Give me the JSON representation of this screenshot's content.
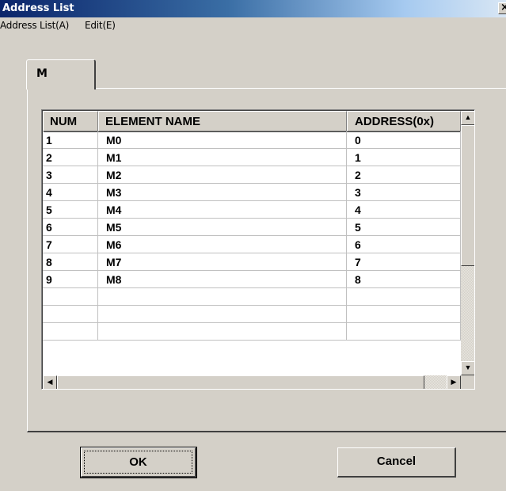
{
  "window": {
    "title": "Address List",
    "close_glyph": "×"
  },
  "menu": [
    {
      "label": "Address List(A)"
    },
    {
      "label": "Edit(E)"
    }
  ],
  "tab": {
    "label": "M"
  },
  "table": {
    "columns": [
      "NUM",
      "ELEMENT NAME",
      "ADDRESS(0x)"
    ],
    "rows": [
      [
        "1",
        "M0",
        "0"
      ],
      [
        "2",
        "M1",
        "1"
      ],
      [
        "3",
        "M2",
        "2"
      ],
      [
        "4",
        "M3",
        "3"
      ],
      [
        "5",
        "M4",
        "4"
      ],
      [
        "6",
        "M5",
        "5"
      ],
      [
        "7",
        "M6",
        "6"
      ],
      [
        "8",
        "M7",
        "7"
      ],
      [
        "9",
        "M8",
        "8"
      ],
      [
        "",
        "",
        ""
      ],
      [
        "",
        "",
        ""
      ],
      [
        "",
        "",
        ""
      ]
    ]
  },
  "scroll": {
    "up": "▲",
    "down": "▼",
    "left": "◀",
    "right": "▶"
  },
  "buttons": {
    "ok": "OK",
    "cancel": "Cancel"
  }
}
